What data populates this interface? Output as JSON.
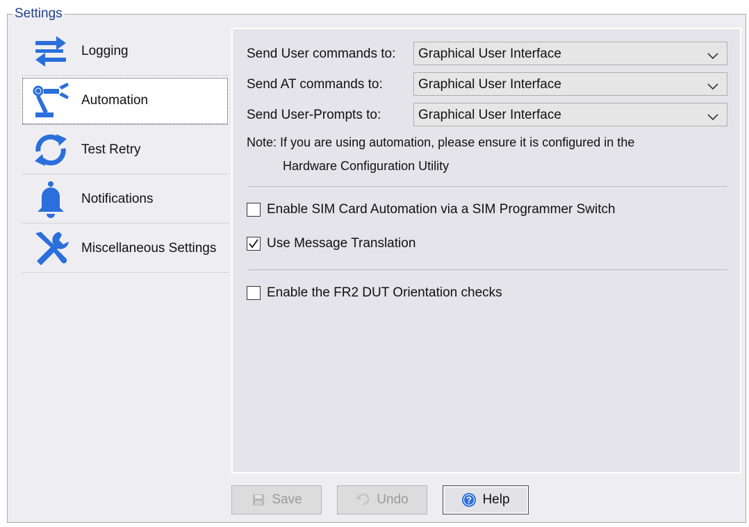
{
  "group_title": "Settings",
  "sidebar": {
    "items": [
      {
        "label": "Logging",
        "icon": "transfer-arrows-icon",
        "selected": false
      },
      {
        "label": "Automation",
        "icon": "robot-arm-icon",
        "selected": true
      },
      {
        "label": "Test Retry",
        "icon": "refresh-icon",
        "selected": false
      },
      {
        "label": "Notifications",
        "icon": "bell-icon",
        "selected": false
      },
      {
        "label": "Miscellaneous Settings",
        "icon": "wrench-screwdriver-icon",
        "selected": false
      }
    ]
  },
  "automation": {
    "user_commands_label": "Send User commands to:",
    "user_commands_value": "Graphical User Interface",
    "at_commands_label": "Send AT commands to:",
    "at_commands_value": "Graphical User Interface",
    "user_prompts_label": "Send User-Prompts to:",
    "user_prompts_value": "Graphical User Interface",
    "note_line1": "Note: If you are using automation, please ensure it is configured in the",
    "note_line2": "Hardware Configuration Utility",
    "sim_card_label": "Enable SIM Card Automation via a SIM Programmer Switch",
    "sim_card_checked": false,
    "message_translation_label": "Use Message Translation",
    "message_translation_checked": true,
    "fr2_label": "Enable the FR2 DUT Orientation checks",
    "fr2_checked": false
  },
  "buttons": {
    "save": "Save",
    "undo": "Undo",
    "help": "Help"
  },
  "colors": {
    "accent_blue": "#2a6fdb",
    "title_blue": "#1e3f8a"
  }
}
